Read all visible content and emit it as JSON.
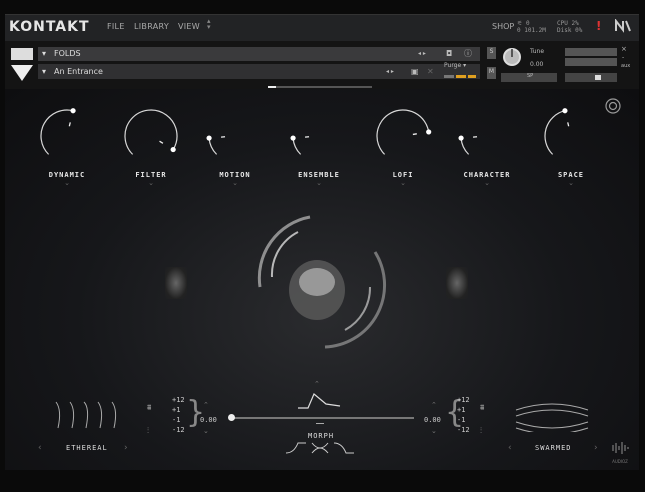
{
  "app": {
    "logo": "KONTAKT"
  },
  "menu": {
    "file": "FILE",
    "library": "LIBRARY",
    "view": "VIEW"
  },
  "topbar": {
    "shop": "SHOP",
    "voices": "0",
    "memory": "0 101.2M",
    "cpu_label": "CPU",
    "cpu_value": "2%",
    "disk_label": "Disk",
    "disk_value": "0%"
  },
  "instrument": {
    "name": "FOLDS",
    "snapshot": "An Entrance",
    "purge_label": "Purge",
    "tune_label": "Tune",
    "tune_value": "0.00",
    "s_label": "S",
    "m_label": "M",
    "aux_label": "aux",
    "pan_label": "SP"
  },
  "knobs": [
    {
      "label": "DYNAMIC",
      "value": 0.55
    },
    {
      "label": "FILTER",
      "value": 0.95
    },
    {
      "label": "MOTION",
      "value": 0.15
    },
    {
      "label": "ENSEMBLE",
      "value": 0.15
    },
    {
      "label": "LOFI",
      "value": 0.8
    },
    {
      "label": "CHARACTER",
      "value": 0.15
    },
    {
      "label": "SPACE",
      "value": 0.45
    }
  ],
  "bottom": {
    "left_preset": "ETHEREAL",
    "right_preset": "SWARMED",
    "morph_label": "MORPH",
    "morph_value": 0.0,
    "left_value": "0.00",
    "right_value": "0.00",
    "range_plus12": "+12",
    "range_plus1": "+1",
    "range_minus1": "-1",
    "range_minus12": "-12",
    "brand": "AUDIOZ"
  },
  "colors": {
    "accent": "#e8e8e8",
    "panel": "#16171a",
    "purge_bar": "#e0a020"
  }
}
